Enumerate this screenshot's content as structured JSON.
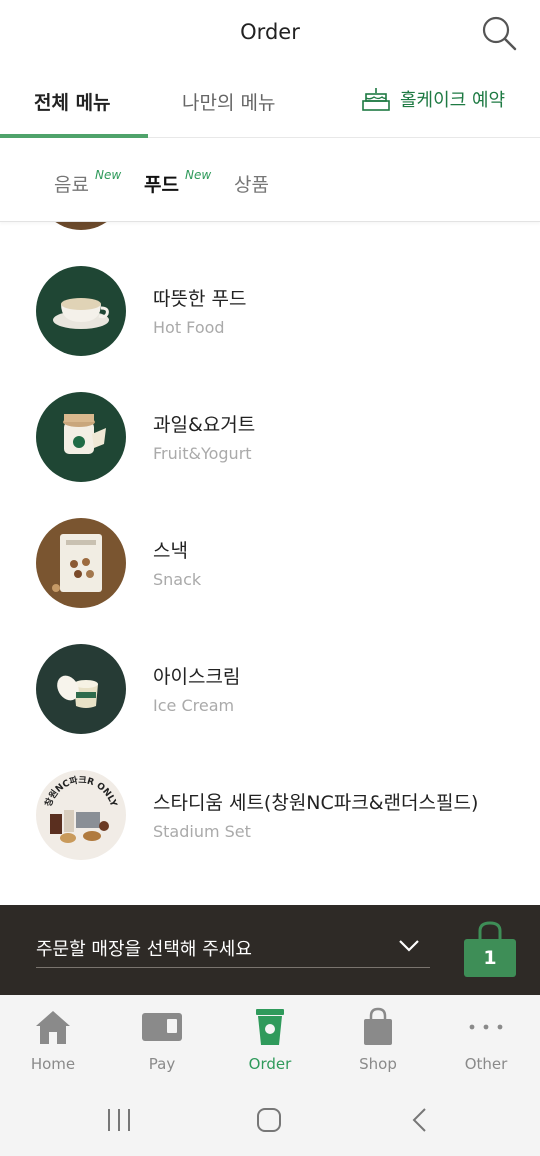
{
  "header": {
    "title": "Order"
  },
  "top_tabs": {
    "all_menu": "전체 메뉴",
    "my_menu": "나만의 메뉴",
    "cake": "홀케이크 예약"
  },
  "sub_tabs": [
    {
      "label": "음료",
      "badge": "New"
    },
    {
      "label": "푸드",
      "badge": "New"
    },
    {
      "label": "상품"
    }
  ],
  "categories": [
    {
      "name": "따뜻한 푸드",
      "en": "Hot Food",
      "bg": "#1f4634"
    },
    {
      "name": "과일&요거트",
      "en": "Fruit&Yogurt",
      "bg": "#1f4634"
    },
    {
      "name": "스낵",
      "en": "Snack",
      "bg": "#7a5530"
    },
    {
      "name": "아이스크림",
      "en": "Ice Cream",
      "bg": "#263b35"
    },
    {
      "name": "스타디움 세트(창원NC파크&랜더스필드)",
      "en": "Stadium Set",
      "bg": "#f1ece6",
      "badge": "창원NC파크R ONLY"
    }
  ],
  "store_bar": {
    "text": "주문할 매장을 선택해 주세요",
    "cart_count": "1"
  },
  "bottom_nav": [
    {
      "label": "Home",
      "icon": "home-icon"
    },
    {
      "label": "Pay",
      "icon": "card-icon"
    },
    {
      "label": "Order",
      "icon": "cup-icon",
      "active": true
    },
    {
      "label": "Shop",
      "icon": "bag-icon"
    },
    {
      "label": "Other",
      "icon": "more-icon"
    }
  ],
  "colors": {
    "accent": "#2f9a5b",
    "dark_green": "#1f4634",
    "store_bar": "#2e2a26"
  }
}
